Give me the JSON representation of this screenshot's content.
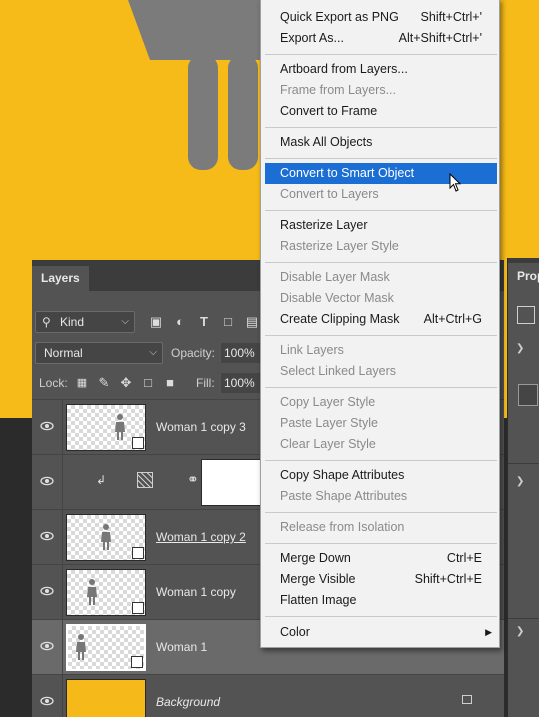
{
  "colors": {
    "canvas_bg": "#f6bb18",
    "menu_highlight": "#1b6ed3",
    "panel_bg": "#535353"
  },
  "layers_panel": {
    "tab_label": "Layers",
    "filter": {
      "label": "Kind"
    },
    "blend_mode": "Normal",
    "opacity_label": "Opacity:",
    "opacity_value": "100%",
    "lock_label": "Lock:",
    "fill_label": "Fill:",
    "fill_value": "100%",
    "layers": [
      {
        "name": "Woman 1 copy 3",
        "type": "smart-object"
      },
      {
        "name": "",
        "type": "adjustment"
      },
      {
        "name": "Woman 1 copy 2",
        "type": "smart-object"
      },
      {
        "name": "Woman 1 copy",
        "type": "smart-object"
      },
      {
        "name": "Woman 1",
        "type": "smart-object",
        "selected": true
      },
      {
        "name": "Background",
        "type": "background",
        "locked": true
      }
    ]
  },
  "properties_panel": {
    "tab_label": "Prop"
  },
  "context_menu": {
    "items": [
      {
        "label": "Quick Export as PNG",
        "shortcut": "Shift+Ctrl+'"
      },
      {
        "label": "Export As...",
        "shortcut": "Alt+Shift+Ctrl+'"
      },
      {
        "label": "Artboard from Layers..."
      },
      {
        "label": "Frame from Layers...",
        "disabled": true
      },
      {
        "label": "Convert to Frame"
      },
      {
        "label": "Mask All Objects"
      },
      {
        "label": "Convert to Smart Object",
        "highlighted": true
      },
      {
        "label": "Convert to Layers",
        "disabled": true
      },
      {
        "label": "Rasterize Layer"
      },
      {
        "label": "Rasterize Layer Style",
        "disabled": true
      },
      {
        "label": "Disable Layer Mask",
        "disabled": true
      },
      {
        "label": "Disable Vector Mask",
        "disabled": true
      },
      {
        "label": "Create Clipping Mask",
        "shortcut": "Alt+Ctrl+G"
      },
      {
        "label": "Link Layers",
        "disabled": true
      },
      {
        "label": "Select Linked Layers",
        "disabled": true
      },
      {
        "label": "Copy Layer Style",
        "disabled": true
      },
      {
        "label": "Paste Layer Style",
        "disabled": true
      },
      {
        "label": "Clear Layer Style",
        "disabled": true
      },
      {
        "label": "Copy Shape Attributes"
      },
      {
        "label": "Paste Shape Attributes",
        "disabled": true
      },
      {
        "label": "Release from Isolation",
        "disabled": true
      },
      {
        "label": "Merge Down",
        "shortcut": "Ctrl+E"
      },
      {
        "label": "Merge Visible",
        "shortcut": "Shift+Ctrl+E"
      },
      {
        "label": "Flatten Image"
      },
      {
        "label": "Color",
        "submenu": true
      }
    ]
  }
}
